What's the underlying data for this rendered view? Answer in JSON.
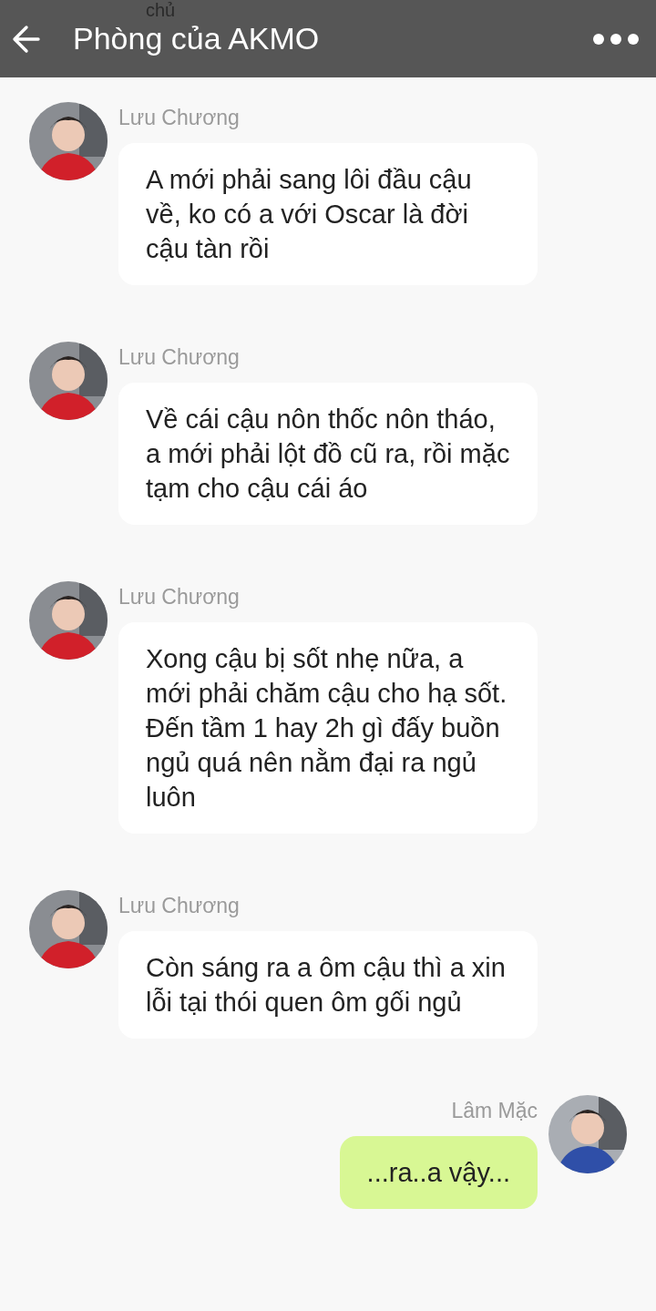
{
  "header": {
    "title": "Phòng của AKMO",
    "scrolled_text": "chủ"
  },
  "messages": [
    {
      "kind": "incoming",
      "sender": "Lưu Chương",
      "text": "A mới phải sang lôi đầu cậu về, ko có a với Oscar là đời cậu tàn rồi"
    },
    {
      "kind": "incoming",
      "sender": "Lưu Chương",
      "text": "Về cái cậu nôn thốc nôn tháo, a mới phải lột đồ cũ ra, rồi mặc tạm cho cậu cái áo"
    },
    {
      "kind": "incoming",
      "sender": "Lưu Chương",
      "text": "Xong cậu bị sốt nhẹ nữa, a mới phải chăm cậu cho hạ sốt. Đến tầm 1 hay 2h  gì đấy buồn ngủ quá nên nằm đại ra ngủ luôn"
    },
    {
      "kind": "incoming",
      "sender": "Lưu Chương",
      "text": "Còn sáng ra a ôm cậu thì a xin lỗi tại thói quen ôm gối ngủ"
    },
    {
      "kind": "outgoing",
      "sender": "Lâm Mặc",
      "text": "...ra..a vậy..."
    }
  ]
}
